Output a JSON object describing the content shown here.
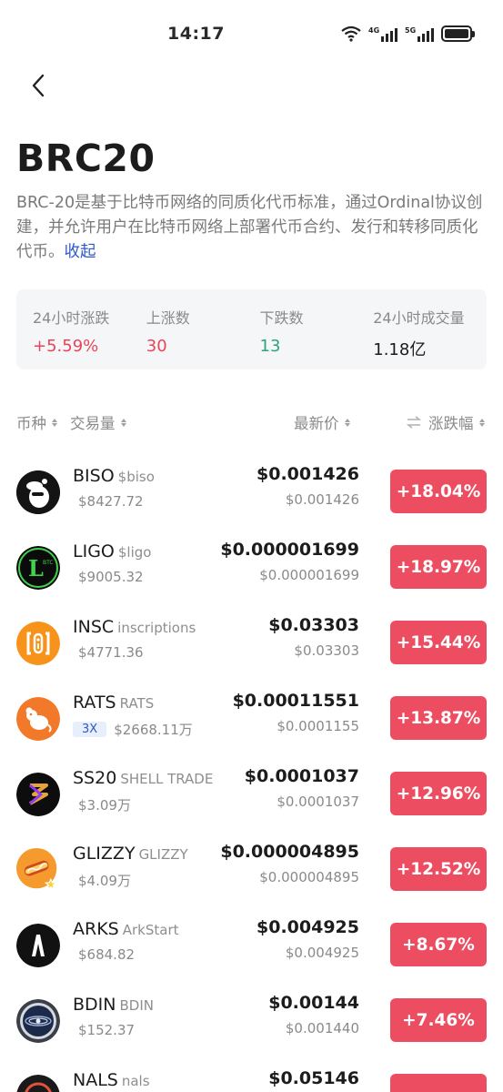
{
  "status": {
    "time": "14:17",
    "net1": "4G",
    "net2": "5G"
  },
  "header": {
    "title": "BRC20",
    "description": "BRC-20是基于比特币网络的同质化代币标准，通过Ordinal协议创建，并允许用户在比特币网络上部署代币合约、发行和转移同质化代币。",
    "collapse_label": "收起"
  },
  "stats": [
    {
      "label": "24小时涨跌",
      "value": "+5.59%",
      "tone": "red"
    },
    {
      "label": "上涨数",
      "value": "30",
      "tone": "red"
    },
    {
      "label": "下跌数",
      "value": "13",
      "tone": "green"
    },
    {
      "label": "24小时成交量",
      "value": "1.18亿",
      "tone": "dark"
    }
  ],
  "columns": {
    "coin": "币种",
    "volume": "交易量",
    "price": "最新价",
    "change": "涨跌幅"
  },
  "rows": [
    {
      "ticker": "BISO",
      "name": "$biso",
      "volume": "$8427.72",
      "leverage": "",
      "price": "$0.001426",
      "sub_price": "$0.001426",
      "change": "+18.04%",
      "icon": "biso-icon"
    },
    {
      "ticker": "LIGO",
      "name": "$ligo",
      "volume": "$9005.32",
      "leverage": "",
      "price": "$0.000001699",
      "sub_price": "$0.000001699",
      "change": "+18.97%",
      "icon": "ligo-icon"
    },
    {
      "ticker": "INSC",
      "name": "inscriptions",
      "volume": "$4771.36",
      "leverage": "",
      "price": "$0.03303",
      "sub_price": "$0.03303",
      "change": "+15.44%",
      "icon": "insc-icon"
    },
    {
      "ticker": "RATS",
      "name": "RATS",
      "volume": "$2668.11万",
      "leverage": "3X",
      "price": "$0.00011551",
      "sub_price": "$0.0001155",
      "change": "+13.87%",
      "icon": "rats-icon"
    },
    {
      "ticker": "SS20",
      "name": "SHELL TRADE",
      "volume": "$3.09万",
      "leverage": "",
      "price": "$0.0001037",
      "sub_price": "$0.0001037",
      "change": "+12.96%",
      "icon": "ss20-icon"
    },
    {
      "ticker": "GLIZZY",
      "name": "GLIZZY",
      "volume": "$4.09万",
      "leverage": "",
      "price": "$0.000004895",
      "sub_price": "$0.000004895",
      "change": "+12.52%",
      "icon": "glizzy-icon"
    },
    {
      "ticker": "ARKS",
      "name": "ArkStart",
      "volume": "$684.82",
      "leverage": "",
      "price": "$0.004925",
      "sub_price": "$0.004925",
      "change": "+8.67%",
      "icon": "arks-icon"
    },
    {
      "ticker": "BDIN",
      "name": "BDIN",
      "volume": "$152.37",
      "leverage": "",
      "price": "$0.00144",
      "sub_price": "$0.001440",
      "change": "+7.46%",
      "icon": "bdin-icon"
    },
    {
      "ticker": "NALS",
      "name": "nals",
      "volume": "",
      "leverage": "",
      "price": "$0.05146",
      "sub_price": "",
      "change": "",
      "icon": "nals-icon"
    }
  ],
  "colors": {
    "up": "#ec4d60",
    "down": "#2ea37a",
    "link": "#2f58c8"
  }
}
